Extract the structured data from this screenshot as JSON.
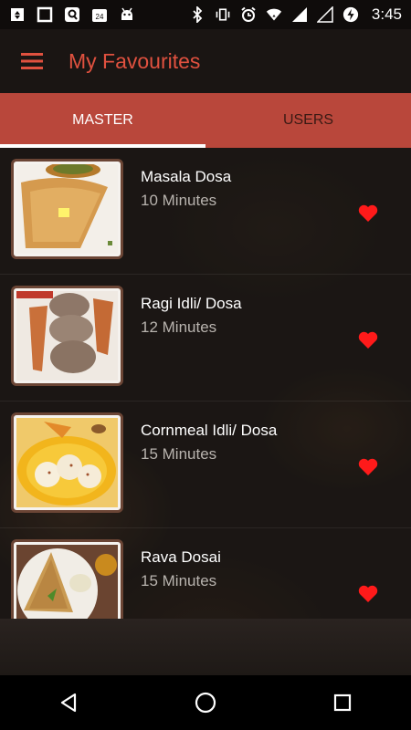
{
  "status_bar": {
    "time": "3:45",
    "calendar_day": "24"
  },
  "app_bar": {
    "title": "My Favourites"
  },
  "tabs": [
    {
      "label": "MASTER",
      "active": true
    },
    {
      "label": "USERS",
      "active": false
    }
  ],
  "favourites": [
    {
      "name": "Masala Dosa",
      "time": "10 Minutes",
      "favourite": true
    },
    {
      "name": "Ragi Idli/ Dosa",
      "time": "12 Minutes",
      "favourite": true
    },
    {
      "name": "Cornmeal Idli/ Dosa",
      "time": "15 Minutes",
      "favourite": true
    },
    {
      "name": "Rava Dosai",
      "time": "15 Minutes",
      "favourite": true
    }
  ],
  "colors": {
    "accent": "#e0513f",
    "tab_bar": "#b9473b",
    "heart": "#ff1a1a"
  }
}
